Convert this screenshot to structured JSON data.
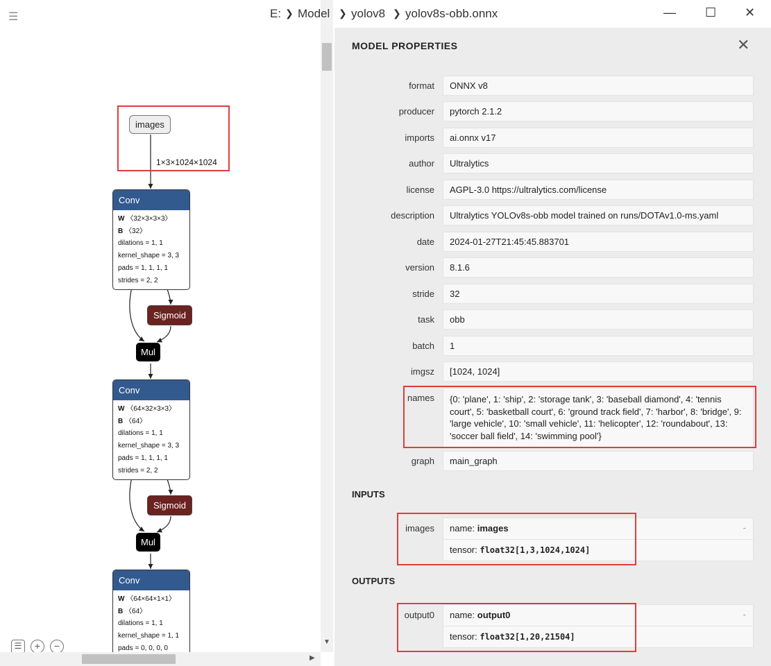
{
  "breadcrumb": [
    "E:",
    "Model",
    "yolov8",
    "yolov8s-obb.onnx"
  ],
  "window_controls": {
    "minimize": "—",
    "maximize": "☐",
    "close": "✕"
  },
  "menu_icon": "☰",
  "graph": {
    "input_node": "images",
    "input_edge_label": "1×3×1024×1024",
    "convs": [
      {
        "title": "Conv",
        "w": "〈32×3×3×3〉",
        "b": "〈32〉",
        "dilations": "dilations = 1, 1",
        "kernel": "kernel_shape = 3, 3",
        "pads": "pads = 1, 1, 1, 1",
        "strides": "strides = 2, 2"
      },
      {
        "title": "Conv",
        "w": "〈64×32×3×3〉",
        "b": "〈64〉",
        "dilations": "dilations = 1, 1",
        "kernel": "kernel_shape = 3, 3",
        "pads": "pads = 1, 1, 1, 1",
        "strides": "strides = 2, 2"
      },
      {
        "title": "Conv",
        "w": "〈64×64×1×1〉",
        "b": "〈64〉",
        "dilations": "dilations = 1, 1",
        "kernel": "kernel_shape = 1, 1",
        "pads": "pads = 0, 0, 0, 0"
      }
    ],
    "sigmoid_label": "Sigmoid",
    "mul_label": "Mul",
    "w_key": "W",
    "b_key": "B"
  },
  "zoom_tools": {
    "list": "☰",
    "zoom_in": "+",
    "zoom_out": "−"
  },
  "panel": {
    "title": "MODEL PROPERTIES",
    "close": "✕",
    "properties": [
      {
        "label": "format",
        "value": "ONNX v8"
      },
      {
        "label": "producer",
        "value": "pytorch 2.1.2"
      },
      {
        "label": "imports",
        "value": "ai.onnx v17"
      },
      {
        "label": "author",
        "value": "Ultralytics"
      },
      {
        "label": "license",
        "value": "AGPL-3.0 https://ultralytics.com/license"
      },
      {
        "label": "description",
        "value": "Ultralytics YOLOv8s-obb model trained on runs/DOTAv1.0-ms.yaml"
      },
      {
        "label": "date",
        "value": "2024-01-27T21:45:45.883701"
      },
      {
        "label": "version",
        "value": "8.1.6"
      },
      {
        "label": "stride",
        "value": "32"
      },
      {
        "label": "task",
        "value": "obb"
      },
      {
        "label": "batch",
        "value": "1"
      },
      {
        "label": "imgsz",
        "value": "[1024, 1024]"
      },
      {
        "label": "names",
        "value": "{0: 'plane', 1: 'ship', 2: 'storage tank', 3: 'baseball diamond', 4: 'tennis court', 5: 'basketball court', 6: 'ground track field', 7: 'harbor', 8: 'bridge', 9: 'large vehicle', 10: 'small vehicle', 11: 'helicopter', 12: 'roundabout', 13: 'soccer ball field', 14: 'swimming pool'}"
      },
      {
        "label": "graph",
        "value": "main_graph"
      }
    ],
    "inputs_title": "INPUTS",
    "inputs": [
      {
        "label": "images",
        "name_key": "name: ",
        "name": "images",
        "tensor_key": "tensor: ",
        "tensor": "float32[1,3,1024,1024]",
        "dash": "-"
      }
    ],
    "outputs_title": "OUTPUTS",
    "outputs": [
      {
        "label": "output0",
        "name_key": "name: ",
        "name": "output0",
        "tensor_key": "tensor: ",
        "tensor": "float32[1,20,21504]",
        "dash": "-"
      }
    ]
  }
}
